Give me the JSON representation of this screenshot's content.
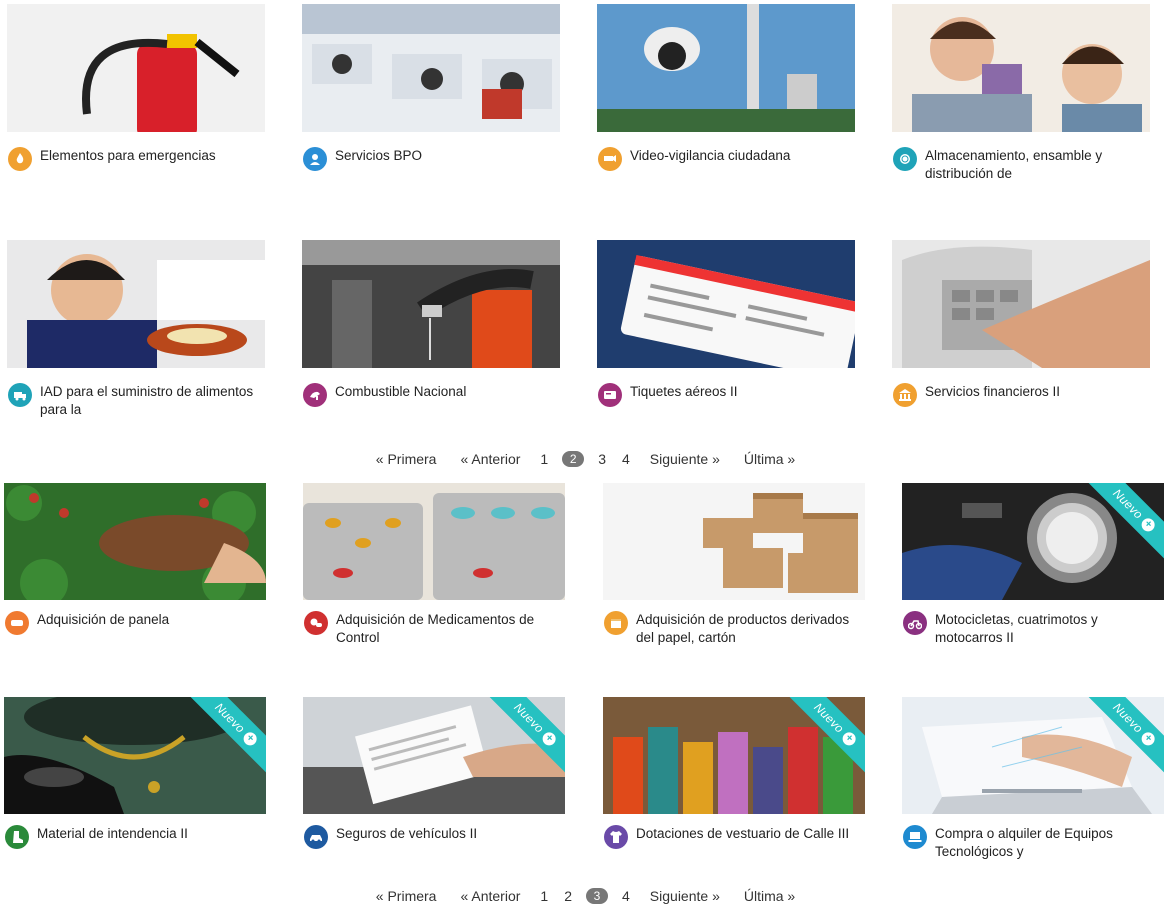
{
  "colors": {
    "ribbon": "#26c1c1",
    "pager_current_bg": "#777777"
  },
  "grid1": [
    {
      "title": "Elementos para emergencias",
      "icon": "fire-icon",
      "icon_color": "#f0a030"
    },
    {
      "title": "Servicios BPO",
      "icon": "person-icon",
      "icon_color": "#2b8fd6"
    },
    {
      "title": "Video-vigilancia ciudadana",
      "icon": "camera-icon",
      "icon_color": "#f0a030"
    },
    {
      "title": "Almacenamiento, ensamble y distribución de",
      "icon": "plate-icon",
      "icon_color": "#1fa3b8"
    },
    {
      "title": "IAD para el suministro de alimentos para la",
      "icon": "truck-icon",
      "icon_color": "#1fa3b8"
    },
    {
      "title": "Combustible Nacional",
      "icon": "fuel-icon",
      "icon_color": "#a0307a"
    },
    {
      "title": "Tiquetes aéreos II",
      "icon": "ticket-icon",
      "icon_color": "#a0307a"
    },
    {
      "title": "Servicios financieros II",
      "icon": "bank-icon",
      "icon_color": "#f0a030"
    }
  ],
  "grid2": [
    {
      "title": "Adquisición de panela",
      "icon": "panela-icon",
      "icon_color": "#f07a30",
      "nuevo": false
    },
    {
      "title": "Adquisición de Medicamentos de Control",
      "icon": "pills-icon",
      "icon_color": "#d03030",
      "nuevo": false
    },
    {
      "title": "Adquisición de productos derivados del papel, cartón",
      "icon": "box-icon",
      "icon_color": "#f0a030",
      "nuevo": false
    },
    {
      "title": "Motocicletas, cuatrimotos y motocarros II",
      "icon": "motorcycle-icon",
      "icon_color": "#8a3080",
      "nuevo": true
    },
    {
      "title": "Material de intendencia II",
      "icon": "boot-icon",
      "icon_color": "#2a8a3a",
      "nuevo": true
    },
    {
      "title": "Seguros de vehículos II",
      "icon": "car-icon",
      "icon_color": "#1e5aa0",
      "nuevo": true
    },
    {
      "title": "Dotaciones de vestuario de Calle III",
      "icon": "shirt-icon",
      "icon_color": "#6a4aa8",
      "nuevo": true
    },
    {
      "title": "Compra o alquiler de Equipos Tecnológicos y",
      "icon": "laptop-icon",
      "icon_color": "#1e8ad0",
      "nuevo": true
    }
  ],
  "ribbon_label": "Nuevo",
  "pager1": {
    "first": "« Primera",
    "prev": "« Anterior",
    "pages": [
      "1",
      "2",
      "3",
      "4"
    ],
    "current": "2",
    "next": "Siguiente »",
    "last": "Última »"
  },
  "pager2": {
    "first": "« Primera",
    "prev": "« Anterior",
    "pages": [
      "1",
      "2",
      "3",
      "4"
    ],
    "current": "3",
    "next": "Siguiente »",
    "last": "Última »"
  }
}
